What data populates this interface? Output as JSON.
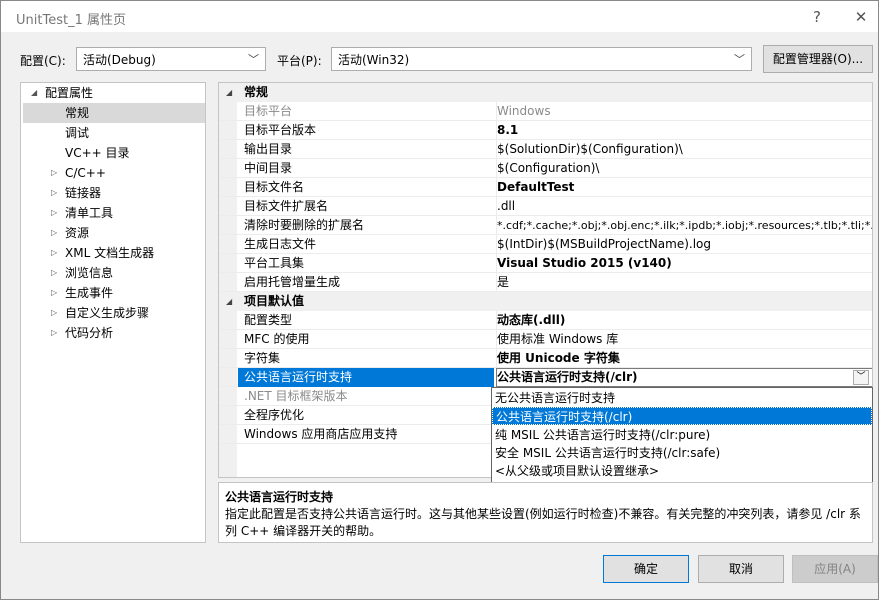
{
  "window": {
    "title": "UnitTest_1 属性页",
    "help": "?",
    "close": "✕"
  },
  "config": {
    "label": "配置(C):",
    "value": "活动(Debug)"
  },
  "platform": {
    "label": "平台(P):",
    "value": "活动(Win32)"
  },
  "config_manager_label": "配置管理器(O)...",
  "tree": {
    "root": "配置属性",
    "items": [
      "常规",
      "调试",
      "VC++ 目录",
      "C/C++",
      "链接器",
      "清单工具",
      "资源",
      "XML 文档生成器",
      "浏览信息",
      "生成事件",
      "自定义生成步骤",
      "代码分析"
    ]
  },
  "grid": {
    "cat1": "常规",
    "general": [
      {
        "k": "目标平台",
        "v": "Windows"
      },
      {
        "k": "目标平台版本",
        "v": "8.1"
      },
      {
        "k": "输出目录",
        "v": "$(SolutionDir)$(Configuration)\\"
      },
      {
        "k": "中间目录",
        "v": "$(Configuration)\\"
      },
      {
        "k": "目标文件名",
        "v": "DefaultTest"
      },
      {
        "k": "目标文件扩展名",
        "v": ".dll"
      },
      {
        "k": "清除时要删除的扩展名",
        "v": "*.cdf;*.cache;*.obj;*.obj.enc;*.ilk;*.ipdb;*.iobj;*.resources;*.tlb;*.tli;*.t"
      },
      {
        "k": "生成日志文件",
        "v": "$(IntDir)$(MSBuildProjectName).log"
      },
      {
        "k": "平台工具集",
        "v": "Visual Studio 2015 (v140)"
      },
      {
        "k": "启用托管增量生成",
        "v": "是"
      }
    ],
    "cat2": "项目默认值",
    "defaults": [
      {
        "k": "配置类型",
        "v": "动态库(.dll)"
      },
      {
        "k": "MFC 的使用",
        "v": "使用标准 Windows 库"
      },
      {
        "k": "字符集",
        "v": "使用 Unicode 字符集"
      },
      {
        "k": "公共语言运行时支持",
        "v": "公共语言运行时支持(/clr)"
      },
      {
        "k": ".NET 目标框架版本",
        "v": ""
      },
      {
        "k": "全程序优化",
        "v": ""
      },
      {
        "k": "Windows 应用商店应用支持",
        "v": ""
      }
    ]
  },
  "dropdown_options": [
    "无公共语言运行时支持",
    "公共语言运行时支持(/clr)",
    "纯 MSIL 公共语言运行时支持(/clr:pure)",
    "安全 MSIL 公共语言运行时支持(/clr:safe)",
    "<从父级或项目默认设置继承>"
  ],
  "description": {
    "title": "公共语言运行时支持",
    "body": "指定此配置是否支持公共语言运行时。这与其他某些设置(例如运行时检查)不兼容。有关完整的冲突列表，请参见 /clr 系列 C++ 编译器开关的帮助。"
  },
  "buttons": {
    "ok": "确定",
    "cancel": "取消",
    "apply": "应用(A)"
  },
  "colors": {
    "selection": "#0078d7",
    "tree_selection": "#d9d9d9"
  }
}
